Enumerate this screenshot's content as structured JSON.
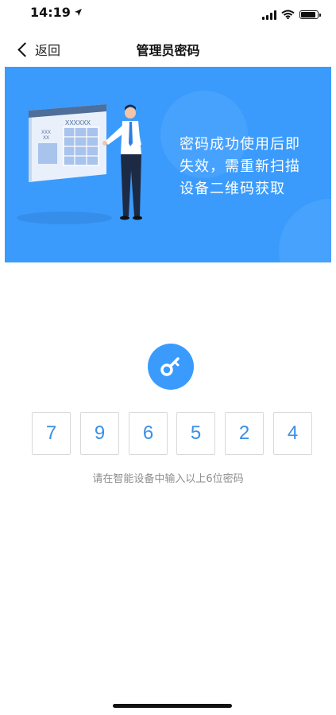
{
  "status_bar": {
    "time": "14:19",
    "location_icon": "location-arrow-icon",
    "signal_icon": "cellular-signal-icon",
    "wifi_icon": "wifi-icon",
    "battery_icon": "battery-icon"
  },
  "nav": {
    "back_label": "返回",
    "back_icon": "chevron-left-icon",
    "title": "管理员密码"
  },
  "banner": {
    "background_color": "#3a9bfd",
    "board_text_1": "XXXXXX",
    "board_text_2": "XXX",
    "board_text_3": "XX",
    "lines": [
      "密码成功使用后即",
      "失效，需重新扫描",
      "设备二维码获取"
    ]
  },
  "code": {
    "icon": "key-icon",
    "accent_color": "#3a8fe8",
    "digits": [
      "7",
      "9",
      "6",
      "5",
      "2",
      "4"
    ],
    "hint": "请在智能设备中输入以上6位密码"
  }
}
